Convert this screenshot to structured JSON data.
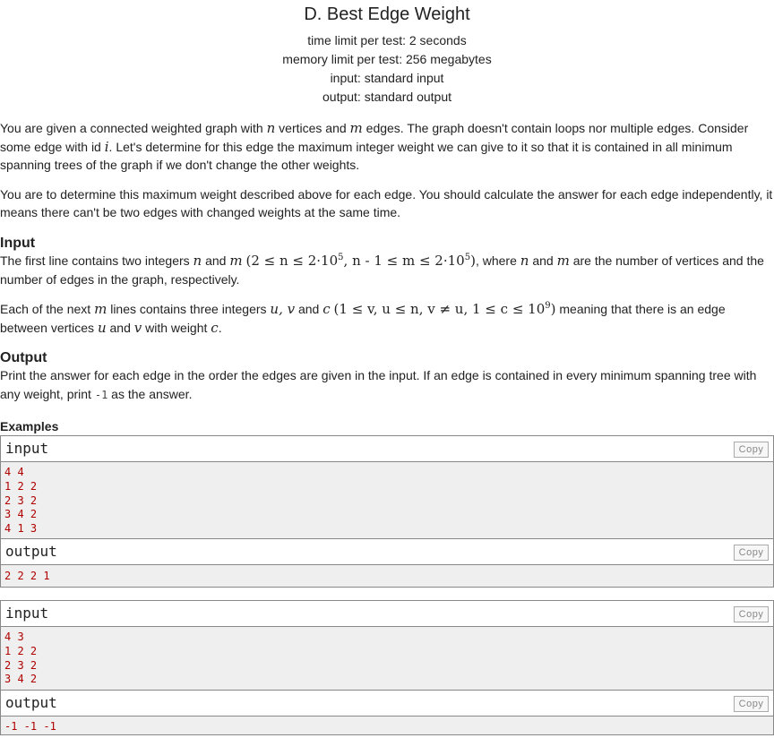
{
  "problem": {
    "title": "D. Best Edge Weight",
    "time_limit": "time limit per test: 2 seconds",
    "memory_limit": "memory limit per test: 256 megabytes",
    "input_spec": "input: standard input",
    "output_spec": "output: standard output"
  },
  "statement": {
    "p1_a": "You are given a connected weighted graph with ",
    "p1_n": "n",
    "p1_b": " vertices and ",
    "p1_m": "m",
    "p1_c": " edges. The graph doesn't contain loops nor multiple edges. Consider some edge with id ",
    "p1_i": "i",
    "p1_d": ". Let's determine for this edge the maximum integer weight we can give to it so that it is contained in all minimum spanning trees of the graph if we don't change the other weights.",
    "p2": "You are to determine this maximum weight described above for each edge. You should calculate the answer for each edge independently, it means there can't be two edges with changed weights at the same time."
  },
  "input_section": {
    "title": "Input",
    "l1_a": "The first line contains two integers ",
    "l1_n": "n",
    "l1_and": " and ",
    "l1_m": "m",
    "l1_cond": "(2 ≤ n ≤ 2·10",
    "l1_exp1": "5",
    "l1_cond2": ", n - 1 ≤ m ≤ 2·10",
    "l1_exp2": "5",
    "l1_close": ")",
    "l1_b": ", where ",
    "l1_n2": "n",
    "l1_and2": " and ",
    "l1_m2": "m",
    "l1_c": " are the number of vertices and the number of edges in the graph, respectively.",
    "l2_a": "Each of the next ",
    "l2_m": "m",
    "l2_b": " lines contains three integers ",
    "l2_uvc": "u, v",
    "l2_and": " and ",
    "l2_c": "c",
    "l2_cond": "(1 ≤ v, u ≤ n, v ≠ u, 1 ≤ c ≤ 10",
    "l2_exp": "9",
    "l2_close": ")",
    "l2_d": " meaning that there is an edge between vertices ",
    "l2_u": "u",
    "l2_and2": " and ",
    "l2_v": "v",
    "l2_e": " with weight ",
    "l2_c2": "c",
    "l2_f": "."
  },
  "output_section": {
    "title": "Output",
    "text_a": "Print the answer for each edge in the order the edges are given in the input. If an edge is contained in every minimum spanning tree with any weight, print ",
    "code": "-1",
    "text_b": " as the answer."
  },
  "examples": {
    "title": "Examples",
    "input_label": "input",
    "output_label": "output",
    "copy_label": "Copy",
    "ex1_input": [
      "4 4",
      "1 2 2",
      "2 3 2",
      "3 4 2",
      "4 1 3"
    ],
    "ex1_output": [
      "2 2 2 1"
    ],
    "ex2_input": [
      "4 3",
      "1 2 2",
      "2 3 2",
      "3 4 2"
    ],
    "ex2_output": [
      "-1 -1 -1"
    ]
  }
}
